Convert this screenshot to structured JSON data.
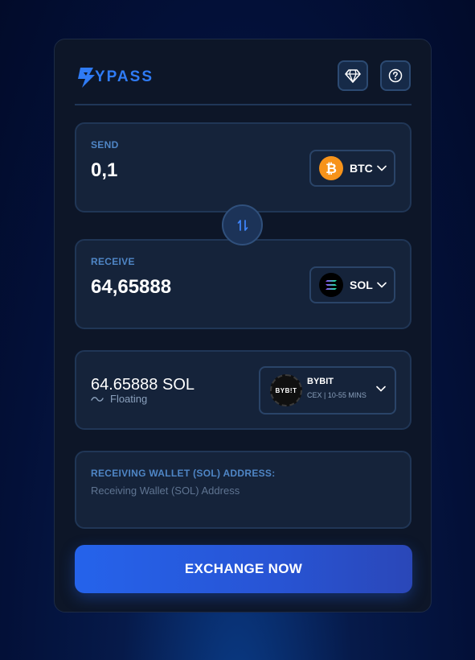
{
  "brand": {
    "name": "YPASS"
  },
  "header": {
    "diamond_icon": "diamond-icon",
    "help_icon": "help-circle-icon"
  },
  "send": {
    "label": "SEND",
    "amount": "0,1",
    "coin": "BTC",
    "coin_color": "#f7931a"
  },
  "receive": {
    "label": "RECEIVE",
    "amount": "64,65888",
    "coin": "SOL"
  },
  "rate": {
    "value": "64.65888 SOL",
    "type": "Floating",
    "exchange": {
      "name": "BYBIT",
      "logo_text": "BYB!T",
      "details": "CEX | 10-55 MINS"
    }
  },
  "wallet": {
    "label": "RECEIVING WALLET (SOL) ADDRESS:",
    "placeholder": "Receiving Wallet (SOL) Address",
    "value": ""
  },
  "cta": {
    "label": "EXCHANGE NOW"
  },
  "colors": {
    "accent": "#2563eb",
    "panel": "#15233a",
    "label": "#4f86c6"
  }
}
